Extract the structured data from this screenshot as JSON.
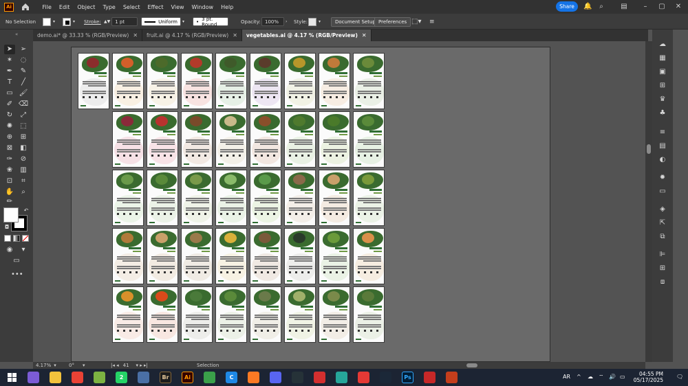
{
  "menubar": {
    "app_logo": "Ai",
    "items": [
      "File",
      "Edit",
      "Object",
      "Type",
      "Select",
      "Effect",
      "View",
      "Window",
      "Help"
    ],
    "share_label": "Share"
  },
  "controlbar": {
    "selection_label": "No Selection",
    "stroke_label": "Stroke:",
    "stroke_value": "1 pt",
    "profile_label": "Uniform",
    "brush_label": "3 pt. Round",
    "opacity_label": "Opacity:",
    "opacity_value": "100%",
    "style_label": "Style:",
    "document_setup": "Document Setup",
    "preferences": "Preferences"
  },
  "tabs": [
    {
      "label": "demo.ai* @ 33.33 % (RGB/Preview)"
    },
    {
      "label": "fruit.ai @ 4.17 % (RGB/Preview)"
    },
    {
      "label": "vegetables.ai @ 4.17 % (RGB/Preview)"
    }
  ],
  "statusbar": {
    "zoom": "4.17%",
    "rotation": "0°",
    "artboard": "41",
    "tool": "Selection"
  },
  "taskbar": {
    "language": "AR",
    "time": "04:55 PM",
    "date": "05/17/2025",
    "apps": [
      {
        "name": "copilot",
        "label": "",
        "color": "#7b5cd6"
      },
      {
        "name": "file-explorer",
        "label": "",
        "color": "#f3c23c"
      },
      {
        "name": "chrome",
        "label": "",
        "color": "#e94235"
      },
      {
        "name": "notepad-plus",
        "label": "",
        "color": "#7cb342"
      },
      {
        "name": "whatsapp",
        "label": "2",
        "color": "#25d366"
      },
      {
        "name": "calculator",
        "label": "",
        "color": "#4a6fa5"
      },
      {
        "name": "bridge",
        "label": "Br",
        "color": "#1c1c1c"
      },
      {
        "name": "illustrator",
        "label": "Ai",
        "color": "#330000"
      },
      {
        "name": "app-green",
        "label": "",
        "color": "#3aa04a"
      },
      {
        "name": "app-c",
        "label": "C",
        "color": "#1e88e5"
      },
      {
        "name": "xampp",
        "label": "",
        "color": "#fb7a24"
      },
      {
        "name": "discord",
        "label": "",
        "color": "#5865f2"
      },
      {
        "name": "app-dark",
        "label": "",
        "color": "#263238"
      },
      {
        "name": "app-red",
        "label": "",
        "color": "#d32f2f"
      },
      {
        "name": "app-blue",
        "label": "",
        "color": "#26a69a"
      },
      {
        "name": "app-diamond",
        "label": "",
        "color": "#e53935"
      },
      {
        "name": "steam",
        "label": "",
        "color": "#1b2838"
      },
      {
        "name": "photoshop",
        "label": "Ps",
        "color": "#001e36"
      },
      {
        "name": "app-s",
        "label": "",
        "color": "#c62828"
      },
      {
        "name": "powerpoint",
        "label": "",
        "color": "#c43e1c"
      }
    ]
  },
  "artboards": {
    "rows": [
      {
        "count": 9,
        "start": 0,
        "tints": [
          "#dcdcdc",
          "#f7e3c6",
          "#f2e7cd",
          "#f4c6c0",
          "#cde2cd",
          "#dccbe6",
          "#e4e7c9",
          "#f1dcc6",
          "#d4e3cc"
        ],
        "vegs": [
          "#8b2c2c",
          "#d35f2a",
          "#4c6a2a",
          "#b23a2a",
          "#3f5a2a",
          "#5a3b2b",
          "#b8962a",
          "#c07a3a",
          "#6a8a3a"
        ]
      },
      {
        "count": 8,
        "start": 1,
        "tints": [
          "#f0c2cb",
          "#f4c6cf",
          "#e7d3c6",
          "#e8e3d1",
          "#e6cec0",
          "#d3e4c8",
          "#d9e6c4",
          "#cfe4c8"
        ],
        "vegs": [
          "#8a2a3a",
          "#b8322e",
          "#7a4a2a",
          "#c9b98a",
          "#8a4f2a",
          "#4f7a2e",
          "#4a7a2a",
          "#5a8a3a"
        ]
      },
      {
        "count": 8,
        "start": 1,
        "tints": [
          "#d8ead1",
          "#d6e7cf",
          "#dfe9d1",
          "#d4e7cd",
          "#d9eac8",
          "#e9ddd0",
          "#ecd8c4",
          "#d6e7cb"
        ],
        "vegs": [
          "#6a9a4a",
          "#5a8a3a",
          "#7a9a4a",
          "#8aba6a",
          "#5a9a4a",
          "#8a6a4a",
          "#c9a06a",
          "#7a9a3a"
        ]
      },
      {
        "count": 8,
        "start": 1,
        "tints": [
          "#eadbc9",
          "#e6d6c4",
          "#e3d8c8",
          "#f1e6c5",
          "#e2d3c6",
          "#dcdcd8",
          "#d5e6c9",
          "#f0dcc0"
        ],
        "vegs": [
          "#b07a3a",
          "#c9a06a",
          "#9a7a4a",
          "#d9b03a",
          "#7a5a3a",
          "#2a3a2a",
          "#6a9a3a",
          "#d9904a"
        ]
      },
      {
        "count": 8,
        "start": 1,
        "tints": [
          "#f4d8cc",
          "#f4cfc0",
          "#dcdcd4",
          "#d9e4cf",
          "#e2ddcf",
          "#e3e8c9",
          "#e6dccd",
          "#d8e3cd"
        ],
        "vegs": [
          "#d9902a",
          "#d94a1a",
          "#4a7a3a",
          "#5a8a3a",
          "#6a7a4a",
          "#a0b06a",
          "#7a8a4a",
          "#5a7a3a"
        ]
      }
    ]
  }
}
